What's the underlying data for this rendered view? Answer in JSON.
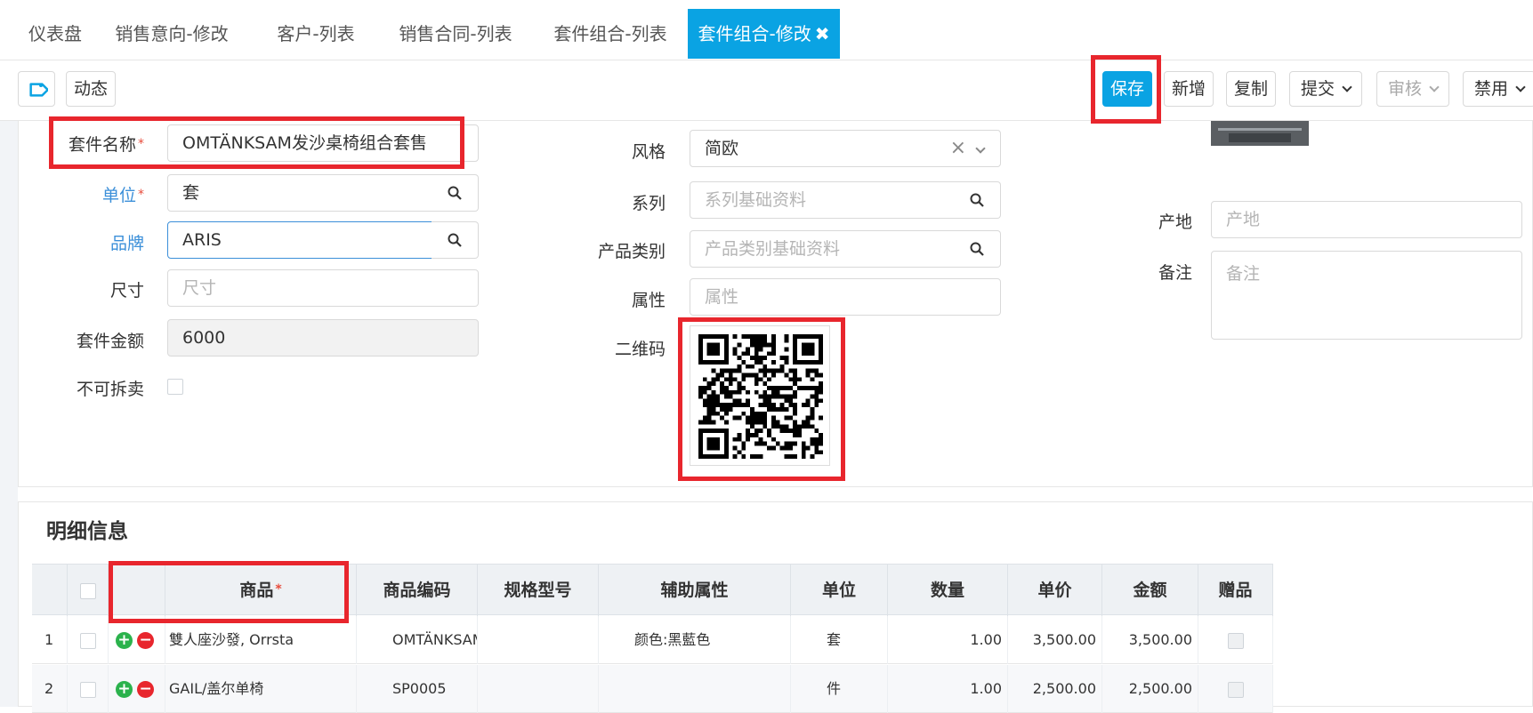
{
  "tabs": [
    {
      "label": "仪表盘"
    },
    {
      "label": "销售意向-修改"
    },
    {
      "label": "客户-列表"
    },
    {
      "label": "销售合同-列表"
    },
    {
      "label": "套件组合-列表"
    },
    {
      "label": "套件组合-修改",
      "close": "✖"
    }
  ],
  "toolbar": {
    "dynamic_label": "动态",
    "save_label": "保存",
    "new_label": "新增",
    "copy_label": "复制",
    "submit_label": "提交",
    "audit_label": "审核",
    "disable_label": "禁用"
  },
  "form": {
    "kit_name": {
      "label": "套件名称",
      "required": "*",
      "value": "OMTÄNKSAM发沙桌椅组合套售"
    },
    "unit": {
      "label": "单位",
      "required": "*",
      "value": "套"
    },
    "brand": {
      "label": "品牌",
      "value": "ARIS"
    },
    "size": {
      "label": "尺寸",
      "placeholder": "尺寸"
    },
    "kit_amount": {
      "label": "套件金额",
      "value": "6000"
    },
    "not_split": {
      "label": "不可拆卖"
    },
    "style": {
      "label": "风格",
      "value": "简欧",
      "clear": "×"
    },
    "series": {
      "label": "系列",
      "placeholder": "系列基础资料"
    },
    "category": {
      "label": "产品类别",
      "placeholder": "产品类别基础资料"
    },
    "attribute": {
      "label": "属性",
      "placeholder": "属性"
    },
    "qrcode": {
      "label": "二维码"
    },
    "origin": {
      "label": "产地",
      "placeholder": "产地"
    },
    "remark": {
      "label": "备注",
      "placeholder": "备注"
    }
  },
  "detail": {
    "title": "明细信息",
    "columns": {
      "product": "商品",
      "product_required": "*",
      "code": "商品编码",
      "spec": "规格型号",
      "aux": "辅助属性",
      "unit": "单位",
      "qty": "数量",
      "price": "单价",
      "amount": "金额",
      "gift": "赠品"
    },
    "rows": [
      {
        "no": "1",
        "product": "雙人座沙發, Orrsta",
        "code": "OMTÄNKSAM",
        "spec": "",
        "aux": "颜色:黑藍色",
        "unit": "套",
        "qty": "1.00",
        "price": "3,500.00",
        "amount": "3,500.00"
      },
      {
        "no": "2",
        "product": "GAIL/盖尔单椅",
        "code": "SP0005",
        "spec": "",
        "aux": "",
        "unit": "件",
        "qty": "1.00",
        "price": "2,500.00",
        "amount": "2,500.00"
      }
    ]
  },
  "colors": {
    "accent": "#0aa3e3",
    "highlight": "#e8262d",
    "link": "#3b8fd9"
  }
}
